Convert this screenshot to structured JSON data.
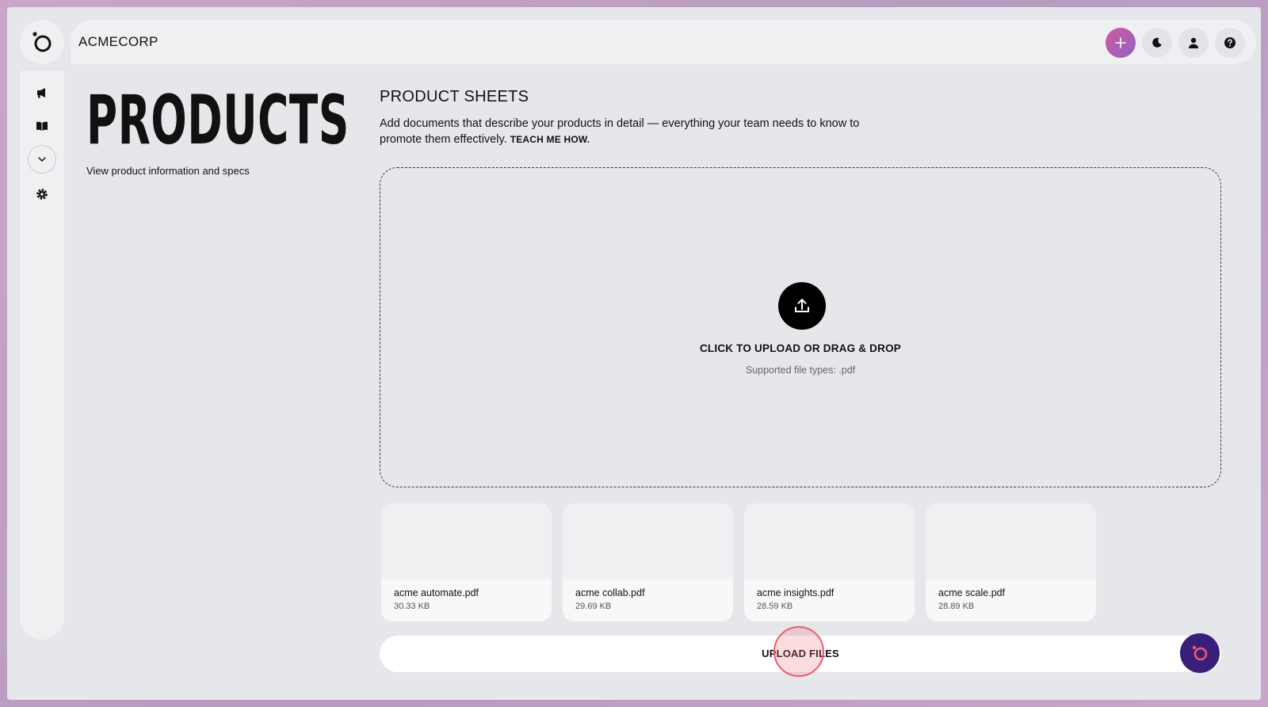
{
  "app": {
    "brand": "ACMECORP"
  },
  "colors": {
    "accent": "#d05a9a",
    "fab": "#3a1f7a",
    "click_ring": "#ef5a6a"
  },
  "icons": {
    "logo": "app-logo-icon",
    "top_actions": [
      "plus-icon",
      "moon-icon",
      "user-icon",
      "help-icon"
    ],
    "sidebar": [
      "megaphone-icon",
      "book-icon",
      "chevron-down-icon",
      "gear-icon"
    ],
    "upload": "upload-icon",
    "fab": "assistant-logo-icon"
  },
  "page": {
    "title": "PRODUCTS",
    "subtitle": "View product information and specs"
  },
  "section": {
    "title": "PRODUCT SHEETS",
    "description": "Add documents that describe your products in detail — everything your team needs to know to promote them effectively.",
    "link": "TEACH ME HOW."
  },
  "dropzone": {
    "title": "CLICK TO UPLOAD OR DRAG & DROP",
    "hint": "Supported file types: .pdf"
  },
  "files": [
    {
      "name": "acme automate.pdf",
      "size": "30.33 KB"
    },
    {
      "name": "acme collab.pdf",
      "size": "29.69 KB"
    },
    {
      "name": "acme insights.pdf",
      "size": "28.59 KB"
    },
    {
      "name": "acme scale.pdf",
      "size": "28.89 KB"
    }
  ],
  "upload_button": {
    "label": "UPLOAD FILES"
  }
}
